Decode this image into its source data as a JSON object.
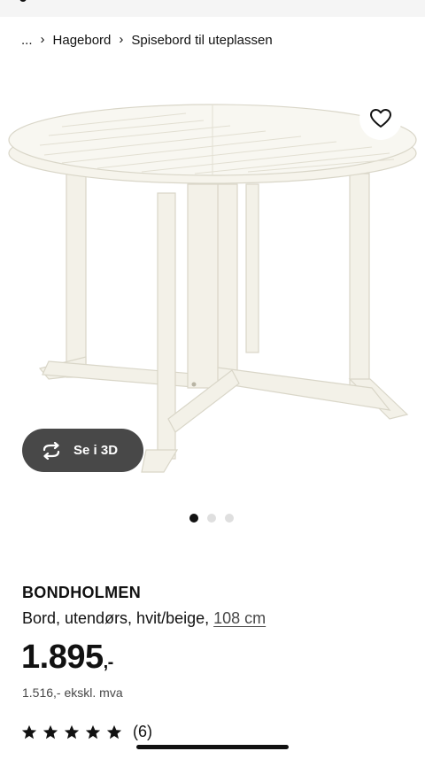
{
  "breadcrumb": {
    "ellipsis": "...",
    "items": [
      {
        "label": "Hagebord"
      },
      {
        "label": "Spisebord til uteplassen"
      }
    ]
  },
  "gallery": {
    "image_alt_icon": "round-outdoor-table",
    "favorite_icon": "heart-outline-icon",
    "view_3d_label": "Se i 3D",
    "view_3d_icon": "rotate-arrows-icon",
    "dots_total": 3,
    "dots_active_index": 0
  },
  "product": {
    "name": "BONDHOLMEN",
    "description": "Bord, utendørs, hvit/beige,",
    "size_link": "108 cm",
    "price_main": "1.895",
    "price_suffix": ",-",
    "price_ex_vat": "1.516,- ekskl. mva",
    "rating_stars": 5,
    "rating_count": "(6)"
  },
  "colors": {
    "text": "#111111",
    "pill_background": "#484848",
    "top_bar": "#f5f5f5",
    "dot_inactive": "#dfdfdf"
  }
}
